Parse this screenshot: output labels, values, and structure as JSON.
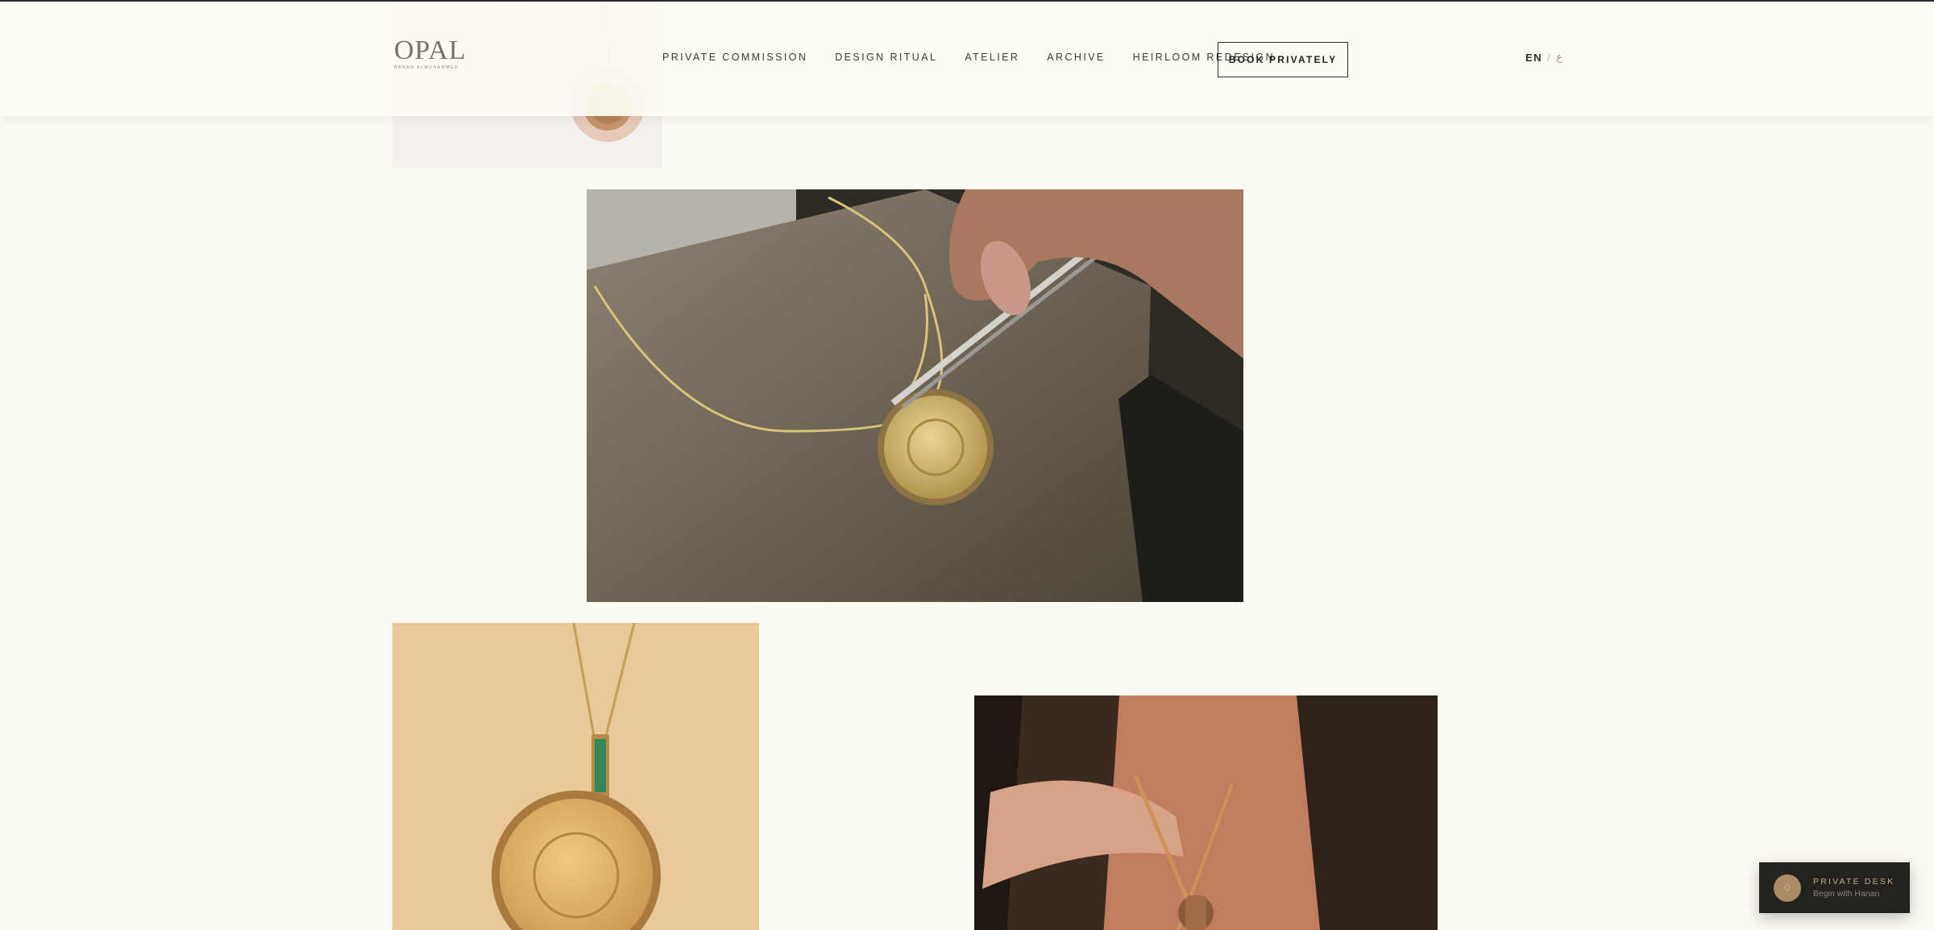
{
  "header": {
    "logo": {
      "word": "OPAL",
      "sub": "HANAN ALMUHAMMED"
    },
    "nav": [
      {
        "label": "PRIVATE COMMISSION"
      },
      {
        "label": "DESIGN RITUAL"
      },
      {
        "label": "ATELIER"
      },
      {
        "label": "ARCHIVE"
      },
      {
        "label": "HEIRLOOM REDESIGN"
      }
    ],
    "cta_label": "BOOK PRIVATELY",
    "language": {
      "current": "EN",
      "separator": "/",
      "alternate": "ع"
    }
  },
  "gallery": [
    {
      "name": "pendant-top-photo"
    },
    {
      "name": "coin-pendant-workbench-photo"
    },
    {
      "name": "emerald-coin-pendant-photo"
    },
    {
      "name": "model-wearing-necklaces-photo"
    }
  ],
  "private_desk": {
    "title": "PRIVATE DESK",
    "subtitle": "Begin with Hanan",
    "icon": "diamond-icon"
  },
  "colors": {
    "background": "#fcfbf3",
    "text": "#3c3a36",
    "accent_gold": "#a98b66",
    "desk_bg": "#23221f"
  }
}
